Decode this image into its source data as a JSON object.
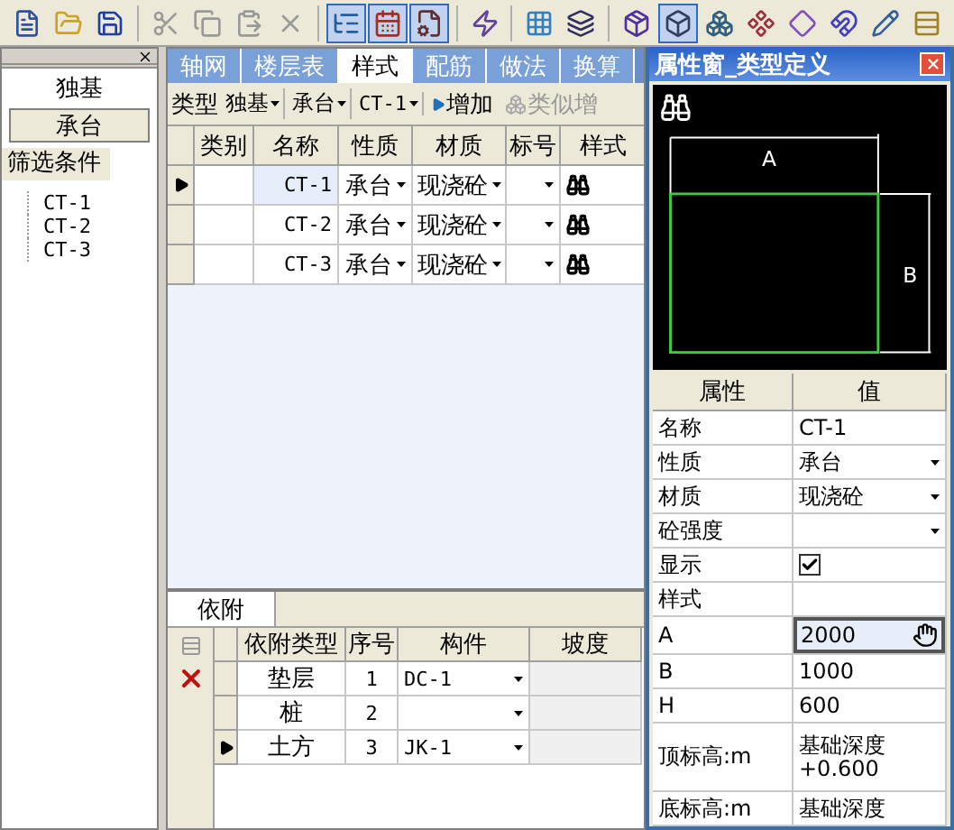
{
  "toolbar": [
    {
      "selected": false
    },
    {
      "selected": false
    },
    {
      "selected": false
    },
    {
      "selected": false
    },
    {
      "selected": false
    },
    {
      "selected": false
    },
    {
      "selected": false
    },
    {
      "selected": true
    },
    {
      "selected": true
    },
    {
      "selected": true
    },
    {
      "selected": false
    },
    {
      "selected": false
    },
    {
      "selected": false
    },
    {
      "selected": false
    },
    {
      "selected": true
    },
    {
      "selected": false
    },
    {
      "selected": false
    },
    {
      "selected": false
    },
    {
      "selected": false
    },
    {
      "selected": false
    },
    {
      "selected": false
    }
  ],
  "left_panel": {
    "categories": [
      {
        "label": "独基",
        "selected": false
      },
      {
        "label": "承台",
        "selected": true
      }
    ],
    "filter_label": "筛选条件",
    "tree": [
      {
        "label": "CT-1"
      },
      {
        "label": "CT-2"
      },
      {
        "label": "CT-3"
      }
    ]
  },
  "tabs": [
    {
      "label": "轴网",
      "selected": false
    },
    {
      "label": "楼层表",
      "selected": false
    },
    {
      "label": "样式",
      "selected": true
    },
    {
      "label": "配筋",
      "selected": false
    },
    {
      "label": "做法",
      "selected": false
    },
    {
      "label": "换算",
      "selected": false
    }
  ],
  "type_bar": {
    "label": "类型",
    "selects": [
      "独基",
      "承台",
      "CT-1"
    ],
    "add": "增加",
    "similar_add": "类似增"
  },
  "grid": {
    "columns": [
      "类别",
      "名称",
      "性质",
      "材质",
      "标号",
      "样式"
    ],
    "rows": [
      {
        "name": "CT-1",
        "nature": "承台",
        "material": "现浇砼",
        "selected": true
      },
      {
        "name": "CT-2",
        "nature": "承台",
        "material": "现浇砼",
        "selected": false
      },
      {
        "name": "CT-3",
        "nature": "承台",
        "material": "现浇砼",
        "selected": false
      }
    ]
  },
  "attach": {
    "tab": "依附",
    "columns": [
      "依附类型",
      "序号",
      "构件",
      "坡度"
    ],
    "rows": [
      {
        "type": "垫层",
        "index": "1",
        "component": "DC-1",
        "selected": false
      },
      {
        "type": "桩",
        "index": "2",
        "component": "",
        "selected": false
      },
      {
        "type": "土方",
        "index": "3",
        "component": "JK-1",
        "selected": true
      }
    ]
  },
  "property_window": {
    "title": "属性窗_类型定义",
    "preview": {
      "dim_a": "A",
      "dim_b": "B"
    },
    "columns": [
      "属性",
      "值"
    ],
    "rows": [
      {
        "kind": "text",
        "name": "名称",
        "value": "CT-1"
      },
      {
        "kind": "select",
        "name": "性质",
        "value": "承台"
      },
      {
        "kind": "select",
        "name": "材质",
        "value": "现浇砼"
      },
      {
        "kind": "select",
        "name": "砼强度",
        "value": ""
      },
      {
        "kind": "check",
        "name": "显示",
        "checked": true
      },
      {
        "kind": "text",
        "name": "样式",
        "value": ""
      },
      {
        "kind": "edit",
        "name": "A",
        "value": "2000"
      },
      {
        "kind": "text",
        "name": "B",
        "value": "1000"
      },
      {
        "kind": "text",
        "name": "H",
        "value": "600"
      },
      {
        "kind": "text",
        "name": "顶标高:m",
        "value": "基础深度\n+0.600"
      },
      {
        "kind": "text",
        "name": "底标高:m",
        "value": "基础深度"
      }
    ]
  }
}
